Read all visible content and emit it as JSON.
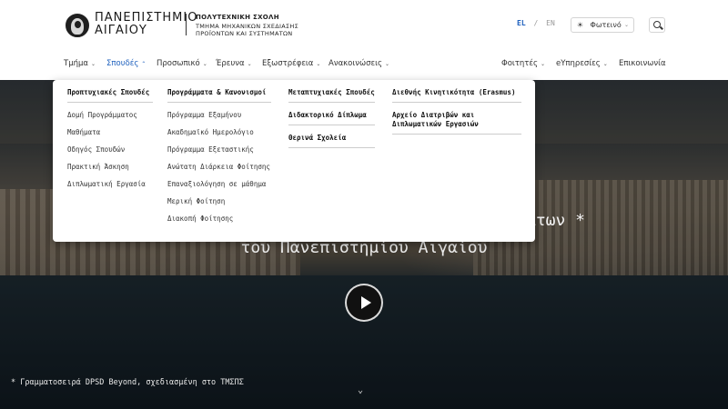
{
  "header": {
    "logo_line1": "ΠΑΝΕΠΙΣΤΗΜΙΟ",
    "logo_line2": "ΑΙΓΑΙΟΥ",
    "school": "ΠΟΛΥΤΕΧΝΙΚΗ ΣΧΟΛΗ",
    "dept_line1": "ΤΜΗΜΑ ΜΗΧΑΝΙΚΩΝ ΣΧΕΔΙΑΣΗΣ",
    "dept_line2": "ΠΡΟΪΟΝΤΩΝ ΚΑΙ ΣΥΣΤΗΜΑΤΩΝ",
    "lang_el": "EL",
    "lang_sep": "/",
    "lang_en": "EN",
    "theme_label": "Φωτεινό",
    "theme_icon": "sun-icon",
    "search_icon": "search-icon"
  },
  "nav": {
    "items": [
      {
        "label": "Τμήμα"
      },
      {
        "label": "Σπουδές"
      },
      {
        "label": "Προσωπικό"
      },
      {
        "label": "Έρευνα"
      },
      {
        "label": "Εξωστρέφεια"
      },
      {
        "label": "Ανακοινώσεις"
      },
      {
        "label": "Φοιτητές"
      },
      {
        "label": "eΥπηρεσίες"
      },
      {
        "label": "Επικοινωνία"
      }
    ],
    "active_color": "#1c5fbd"
  },
  "menu": {
    "undergrad": {
      "title": "Προπτυχιακές Σπουδές",
      "links": [
        "Δομή Προγράμματος",
        "Μαθήματα",
        "Οδηγός Σπουδών",
        "Πρακτική Άσκηση",
        "Διπλωματική Εργασία"
      ]
    },
    "programs": {
      "title": "Προγράμματα & Κανονισμοί",
      "links": [
        "Πρόγραμμα Εξαμήνου",
        "Ακαδημαϊκό Ημερολόγιο",
        "Πρόγραμμα Εξεταστικής",
        "Ανώτατη Διάρκεια Φοίτησης",
        "Επαναξιολόγηση σε μάθημα",
        "Μερική Φοίτηση",
        "Διακοπή Φοίτησης"
      ]
    },
    "postgrad": {
      "title": "Μεταπτυχιακές Σπουδές",
      "phd": "Διδακτορικό Δίπλωμα",
      "summer": "Θερινά Σχολεία"
    },
    "intl": {
      "title": "Διεθνής Κινητικότητα (Erasmus)",
      "archive_line1": "Αρχείο Διατριβών και",
      "archive_line2": "Διπλωματικών Εργασιών"
    }
  },
  "hero": {
    "title_line1_tail": "άτων *",
    "title_line2": "του Πανεπιστημίου Αιγαίου",
    "font_note": "* Γραμματοσειρά DPSD Beyond, σχεδιασμένη στο ΤΜΣΠΣ",
    "play_icon": "play-icon",
    "scroll_icon": "chevron-down-icon"
  }
}
